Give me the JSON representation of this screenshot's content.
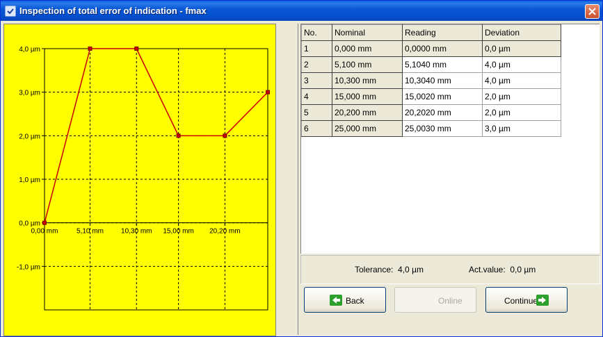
{
  "window": {
    "title": "Inspection of total error of indication - fmax"
  },
  "chart_data": {
    "type": "line",
    "x": [
      0.0,
      5.1,
      10.3,
      15.0,
      20.2,
      25.0
    ],
    "y": [
      0.0,
      4.0,
      4.0,
      2.0,
      2.0,
      3.0
    ],
    "xunit": "mm",
    "yunit": "µm",
    "x_tick_labels": [
      "0,00 mm",
      "5,10 mm",
      "10,30 mm",
      "15,00 mm",
      "20,20 mm"
    ],
    "y_tick_labels": [
      "4,0 µm",
      "3,0 µm",
      "2,0 µm",
      "1,0 µm",
      "0,0 µm",
      "-1,0 µm"
    ],
    "ylim": [
      -2.0,
      4.0
    ],
    "grid": true,
    "line_color": "#cc0000",
    "background": "#ffff00"
  },
  "table": {
    "headers": [
      "No.",
      "Nominal",
      "Reading",
      "Deviation"
    ],
    "rows": [
      [
        "1",
        "0,000 mm",
        "0,0000 mm",
        "0,0 µm"
      ],
      [
        "2",
        "5,100 mm",
        "5,1040 mm",
        "4,0 µm"
      ],
      [
        "3",
        "10,300 mm",
        "10,3040 mm",
        "4,0 µm"
      ],
      [
        "4",
        "15,000 mm",
        "15,0020 mm",
        "2,0 µm"
      ],
      [
        "5",
        "20,200 mm",
        "20,2020 mm",
        "2,0 µm"
      ],
      [
        "6",
        "25,000 mm",
        "25,0030 mm",
        "3,0 µm"
      ]
    ]
  },
  "info": {
    "tolerance_label": "Tolerance:",
    "tolerance_value": "4,0 µm",
    "act_label": "Act.value:",
    "act_value": "0,0 µm"
  },
  "buttons": {
    "back": "Back",
    "online": "Online",
    "continue": "Continue"
  },
  "icons": {
    "back": "green-left-arrow-icon",
    "continue": "green-right-arrow-icon",
    "close": "close-icon"
  }
}
